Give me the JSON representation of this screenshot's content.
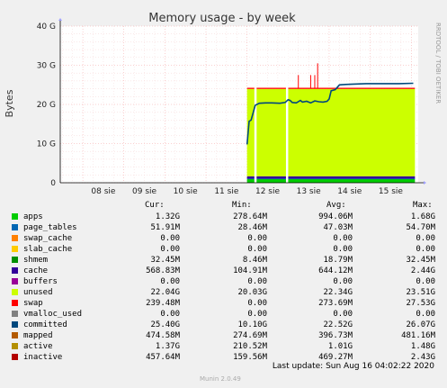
{
  "chart_data": {
    "type": "area",
    "title": "Memory usage - by week",
    "ylabel": "Bytes",
    "side_label": "RRDTOOL / TOBI OETIKER",
    "ylim": [
      0,
      40
    ],
    "y_unit": "G",
    "y_ticks": [
      "0",
      "10 G",
      "20 G",
      "30 G",
      "40 G"
    ],
    "x_ticks": [
      "08 sie",
      "09 sie",
      "10 sie",
      "11 sie",
      "12 sie",
      "13 sie",
      "14 sie",
      "15 sie"
    ],
    "x_tick_days": [
      8,
      9,
      10,
      11,
      12,
      13,
      14,
      15
    ],
    "xlim_days": [
      7.45,
      16.17
    ],
    "data_start_day": 12.0,
    "gaps_days": [
      12.2,
      12.97
    ],
    "stacked_series_approx_G": [
      {
        "name": "apps",
        "color": "#00cc00",
        "level": 1.0
      },
      {
        "name": "page_tables",
        "color": "#0066b3",
        "level": 0.05
      },
      {
        "name": "cache",
        "color": "#330099",
        "level": 0.6
      },
      {
        "name": "unused",
        "color": "#ccff00",
        "level": 22.3
      },
      {
        "name": "swap",
        "color": "#ff0000",
        "level": 0.3
      }
    ],
    "committed_G": {
      "x": [
        12.0,
        12.05,
        12.1,
        12.2,
        12.3,
        12.45,
        12.6,
        12.8,
        12.93,
        13.0,
        13.05,
        13.1,
        13.2,
        13.3,
        13.35,
        13.45,
        13.55,
        13.65,
        13.75,
        13.85,
        13.95,
        14.0,
        14.05,
        14.15,
        14.25,
        14.4,
        14.6,
        14.9,
        15.3,
        15.7,
        16.05
      ],
      "y": [
        9.8,
        15.7,
        16.0,
        19.8,
        20.3,
        20.4,
        20.4,
        20.3,
        20.5,
        21.2,
        21.0,
        20.5,
        20.4,
        21.0,
        20.6,
        20.8,
        20.4,
        20.9,
        20.7,
        20.6,
        20.8,
        21.4,
        23.5,
        23.8,
        25.0,
        25.1,
        25.2,
        25.3,
        25.3,
        25.3,
        25.4
      ]
    },
    "grid": true,
    "legend_headers": [
      "Cur:",
      "Min:",
      "Avg:",
      "Max:"
    ],
    "legend": [
      {
        "name": "apps",
        "color": "#00cc00",
        "cur": "1.32G",
        "min": "278.64M",
        "avg": "994.06M",
        "max": "1.68G"
      },
      {
        "name": "page_tables",
        "color": "#0066b3",
        "cur": "51.91M",
        "min": "28.46M",
        "avg": "47.03M",
        "max": "54.70M"
      },
      {
        "name": "swap_cache",
        "color": "#ff8000",
        "cur": "0.00",
        "min": "0.00",
        "avg": "0.00",
        "max": "0.00"
      },
      {
        "name": "slab_cache",
        "color": "#ffcc00",
        "cur": "0.00",
        "min": "0.00",
        "avg": "0.00",
        "max": "0.00"
      },
      {
        "name": "shmem",
        "color": "#008f00",
        "cur": "32.45M",
        "min": "8.46M",
        "avg": "18.79M",
        "max": "32.45M"
      },
      {
        "name": "cache",
        "color": "#330099",
        "cur": "568.83M",
        "min": "104.91M",
        "avg": "644.12M",
        "max": "2.44G"
      },
      {
        "name": "buffers",
        "color": "#990099",
        "cur": "0.00",
        "min": "0.00",
        "avg": "0.00",
        "max": "0.00"
      },
      {
        "name": "unused",
        "color": "#ccff00",
        "cur": "22.04G",
        "min": "20.03G",
        "avg": "22.34G",
        "max": "23.51G"
      },
      {
        "name": "swap",
        "color": "#ff0000",
        "cur": "239.48M",
        "min": "0.00",
        "avg": "273.69M",
        "max": "27.53G"
      },
      {
        "name": "vmalloc_used",
        "color": "#808080",
        "cur": "0.00",
        "min": "0.00",
        "avg": "0.00",
        "max": "0.00"
      },
      {
        "name": "committed",
        "color": "#00487d",
        "cur": "25.40G",
        "min": "10.10G",
        "avg": "22.52G",
        "max": "26.07G"
      },
      {
        "name": "mapped",
        "color": "#b35a00",
        "cur": "474.58M",
        "min": "274.69M",
        "avg": "396.73M",
        "max": "481.16M"
      },
      {
        "name": "active",
        "color": "#b38f00",
        "cur": "1.37G",
        "min": "210.52M",
        "avg": "1.01G",
        "max": "1.48G"
      },
      {
        "name": "inactive",
        "color": "#b30000",
        "cur": "457.64M",
        "min": "159.56M",
        "avg": "469.27M",
        "max": "2.43G"
      }
    ],
    "last_update": "Last update: Sun Aug 16 04:02:22 2020",
    "generator": "Munin 2.0.49"
  }
}
